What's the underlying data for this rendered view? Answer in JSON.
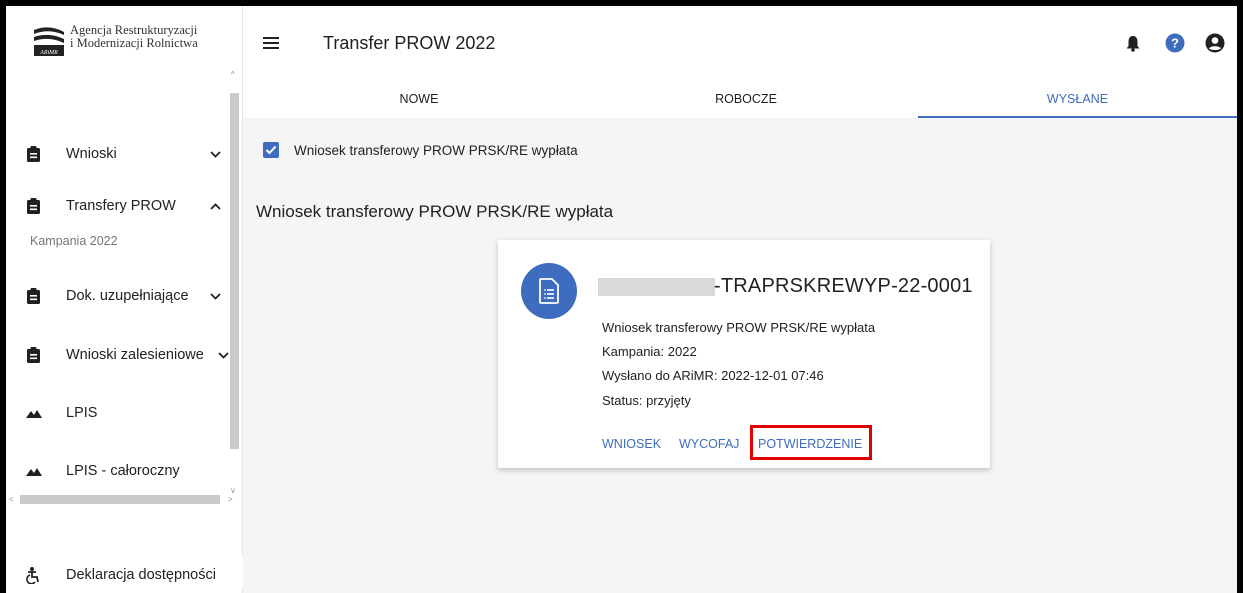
{
  "org": {
    "name_line1": "Agencja Restrukturyzacji",
    "name_line2": "i Modernizacji Rolnictwa",
    "logo_text": "ARiMR"
  },
  "header": {
    "title": "Transfer PROW 2022",
    "icons": [
      "bell-icon",
      "help-icon",
      "account-icon"
    ],
    "accent_color": "#3e6cbf"
  },
  "sidebar": {
    "items": [
      {
        "label": "Wnioski",
        "icon": "clipboard-icon",
        "expanded": false
      },
      {
        "label": "Transfery PROW",
        "icon": "clipboard-icon",
        "expanded": true
      },
      {
        "label": "Dok. uzupełniające",
        "icon": "clipboard-icon",
        "expanded": false
      },
      {
        "label": "Wnioski zalesieniowe",
        "icon": "clipboard-icon",
        "expanded": false
      },
      {
        "label": "LPIS",
        "icon": "mountain-icon"
      },
      {
        "label": "LPIS - całoroczny",
        "icon": "mountain-icon"
      }
    ],
    "sub_item": "Kampania 2022",
    "footer_item": "Deklaracja dostępności"
  },
  "tabs": [
    {
      "label": "NOWE",
      "active": false
    },
    {
      "label": "ROBOCZE",
      "active": false
    },
    {
      "label": "WYSŁANE",
      "active": true
    }
  ],
  "filter": {
    "label": "Wniosek transferowy PROW PRSK/RE wypłata",
    "checked": true
  },
  "section": {
    "title": "Wniosek transferowy PROW PRSK/RE wypłata"
  },
  "card": {
    "id_suffix": "-TRAPRSKREWYP-22-0001",
    "type": "Wniosek transferowy PROW PRSK/RE wypłata",
    "campaign": "Kampania: 2022",
    "sent": "Wysłano do ARiMR: 2022-12-01 07:46",
    "status": "Status: przyjęty",
    "actions": [
      "WNIOSEK",
      "WYCOFAJ",
      "POTWIERDZENIE"
    ],
    "highlight_color": "#e00000"
  }
}
